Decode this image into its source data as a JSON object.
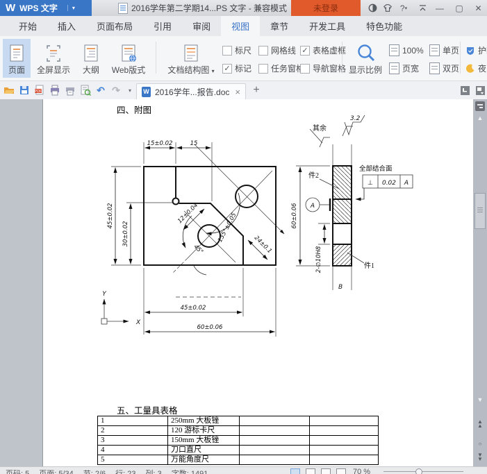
{
  "window": {
    "logo": "W",
    "app_button": "WPS 文字",
    "title": "2016学年第二学期14...PS 文字 - 兼容模式",
    "login": "未登录",
    "icons": [
      "theme-icon",
      "skin-icon",
      "help-icon",
      "collapse-ribbon-icon",
      "minimize-icon",
      "maximize-icon",
      "close-icon"
    ]
  },
  "menu": {
    "tabs": [
      {
        "label": "开始"
      },
      {
        "label": "插入"
      },
      {
        "label": "页面布局"
      },
      {
        "label": "引用"
      },
      {
        "label": "审阅"
      },
      {
        "label": "视图"
      },
      {
        "label": "章节"
      },
      {
        "label": "开发工具"
      },
      {
        "label": "特色功能"
      }
    ]
  },
  "ribbon": {
    "views": [
      {
        "label": "页面"
      },
      {
        "label": "全屏显示"
      },
      {
        "label": "大纲"
      },
      {
        "label": "Web版式"
      }
    ],
    "doc_map_label": "文档结构图",
    "doc_map_arrow": "▾",
    "checkboxes": [
      {
        "label": "标尺",
        "checked": false
      },
      {
        "label": "网格线",
        "checked": false
      },
      {
        "label": "表格虚框",
        "checked": true
      },
      {
        "label": "标记",
        "checked": true
      },
      {
        "label": "任务窗格",
        "checked": false
      },
      {
        "label": "导航窗格",
        "checked": false
      }
    ],
    "check_mark": "✓",
    "zoom_tool_label": "显示比例",
    "zoom_items": [
      {
        "label": "100%"
      },
      {
        "label": "单页"
      },
      {
        "label": "页宽"
      },
      {
        "label": "双页"
      }
    ],
    "eye_label": "护眼",
    "night_label": "夜间"
  },
  "quick_toolbar": {
    "icons": [
      "open-folder-icon",
      "save-icon",
      "export-pdf-icon",
      "print-icon",
      "print-preview-icon",
      "doc-preview-icon",
      "undo-icon",
      "redo-icon"
    ],
    "undo_glyph": "↶",
    "redo_glyph": "↷",
    "more_arrow": "▾"
  },
  "doc_tabs": {
    "active_label": "2016学年...报告.doc",
    "close_glyph": "×",
    "new_tab_glyph": "+"
  },
  "document": {
    "heading1": "四、附图",
    "heading2": "五、工量具表格",
    "table": {
      "rows": [
        {
          "no": "1",
          "name": "250mm 大板锉",
          "col3": "",
          "col4": ""
        },
        {
          "no": "2",
          "name": "120 游标卡尺",
          "col3": "",
          "col4": ""
        },
        {
          "no": "3",
          "name": "150mm 大板锉",
          "col3": "",
          "col4": ""
        },
        {
          "no": "4",
          "name": "刀口直尺",
          "col3": "",
          "col4": ""
        },
        {
          "no": "5",
          "name": "万能角度尺",
          "col3": "",
          "col4": ""
        }
      ]
    },
    "drawing": {
      "surface_note": "其余",
      "surface_value": "3.2",
      "dim_15t": "15±0.02",
      "dim_15": "15",
      "dim_45v": "45±0.02",
      "dim_30v": "30±0.02",
      "dim_12": "12±0.04",
      "dim_135": "135°±0.05",
      "dim_24": "24±0.1",
      "dim_45deg": "45°",
      "dim_45b": "45±0.02",
      "dim_60b": "60±0.06",
      "dim_60s": "60±0.06",
      "dim_holes": "2-∅10H8",
      "part2": "件2",
      "part1": "件1",
      "joint_note": "全部结合面",
      "tol_symbol": "⊥",
      "tol_value": "0.02",
      "tol_datum": "A",
      "datum_label": "A",
      "axis_x": "X",
      "axis_y": "Y",
      "section_label": "B"
    }
  },
  "status_bar": {
    "items": [
      "页码: 5",
      "页面: 5/34",
      "节: 2/6",
      "行: 23",
      "列: 3",
      "字数: 1491"
    ],
    "zoom": "70 %"
  }
}
